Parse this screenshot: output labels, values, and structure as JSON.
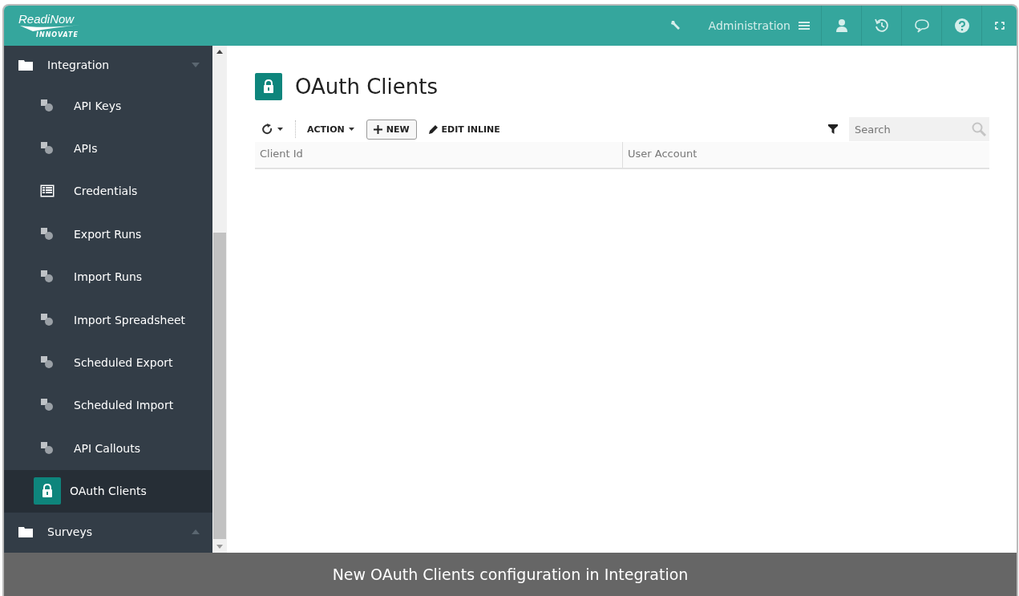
{
  "header": {
    "logo": {
      "name": "ReadiNow",
      "tagline": "INNOVATE"
    },
    "menu_label": "Administration"
  },
  "sidebar": {
    "groups": [
      {
        "label": "Integration",
        "expanded": true,
        "children": [
          {
            "label": "API Keys",
            "kind": "object",
            "selected": false
          },
          {
            "label": "APIs",
            "kind": "object",
            "selected": false
          },
          {
            "label": "Credentials",
            "kind": "table",
            "selected": false
          },
          {
            "label": "Export Runs",
            "kind": "object",
            "selected": false
          },
          {
            "label": "Import Runs",
            "kind": "object",
            "selected": false
          },
          {
            "label": "Import Spreadsheet",
            "kind": "object",
            "selected": false
          },
          {
            "label": "Scheduled Export",
            "kind": "object",
            "selected": false
          },
          {
            "label": "Scheduled Import",
            "kind": "object",
            "selected": false
          },
          {
            "label": "API Callouts",
            "kind": "object",
            "selected": false
          },
          {
            "label": "OAuth Clients",
            "kind": "lock",
            "selected": true
          }
        ]
      },
      {
        "label": "Surveys",
        "expanded": false
      }
    ]
  },
  "page": {
    "title": "OAuth Clients",
    "toolbar": {
      "action": "ACTION",
      "new": "NEW",
      "edit": "EDIT INLINE"
    },
    "search": {
      "placeholder": "Search"
    },
    "table": {
      "columns": [
        "Client Id",
        "User Account"
      ]
    }
  },
  "caption": "New OAuth Clients configuration in Integration"
}
